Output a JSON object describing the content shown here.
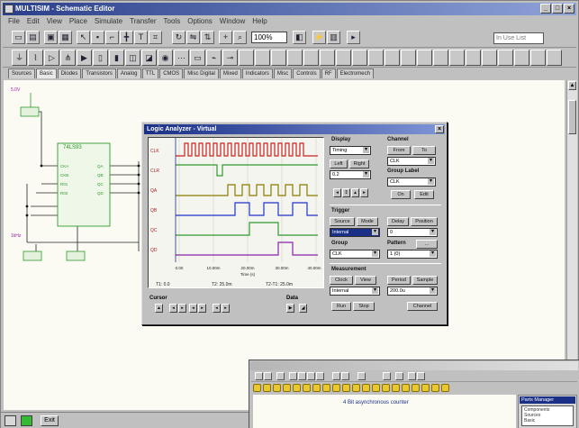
{
  "window": {
    "title": "MULTISIM - Schematic Editor",
    "controls": [
      "_",
      "□",
      "×"
    ]
  },
  "menubar": [
    "File",
    "Edit",
    "View",
    "Place",
    "Simulate",
    "Transfer",
    "Tools",
    "Options",
    "Window",
    "Help"
  ],
  "toolbar": {
    "zoom_value": "100%",
    "search_placeholder": "In Use List"
  },
  "component_tabs": [
    "Sources",
    "Basic",
    "Diodes",
    "Transistors",
    "Analog",
    "TTL",
    "CMOS",
    "Misc Digital",
    "Mixed",
    "Indicators",
    "Misc",
    "Controls",
    "RF",
    "Electromech"
  ],
  "schematic": {
    "ic_label": "74LS93",
    "source_label": "5.0V",
    "clock_label": "1kHz",
    "pins_left": [
      "CKA",
      "CKB",
      "R01",
      "R02"
    ],
    "pins_right": [
      "QA",
      "QB",
      "QC",
      "QD"
    ]
  },
  "logic_analyzer": {
    "title": "Logic Analyzer - Virtual",
    "close_label": "×",
    "channels": [
      "CLK",
      "CLR",
      "QA",
      "QB",
      "QC",
      "QD"
    ],
    "time_ticks": [
      "0.00",
      "10.00m",
      "20.00m",
      "30.00m",
      "40.00m"
    ],
    "x_axis_label": "Time (s)",
    "readouts": {
      "t1": "T1: 0.0",
      "t2": "T2: 25.0m",
      "t2_t1": "T2-T1: 25.0m"
    },
    "cursor_label": "Cursor",
    "data_label": "Data",
    "display": {
      "heading": "Display",
      "select_value": "Timing",
      "left_button": "Left",
      "right_button": "Right",
      "width_value": "0.2"
    },
    "channel": {
      "heading": "Channel",
      "from_button": "From",
      "to_button": "To",
      "select_value": "CLK"
    },
    "group_label": {
      "heading": "Group Label",
      "select_value": "CLK",
      "on_button": "On",
      "edit_button": "Edit"
    },
    "trigger": {
      "heading": "Trigger",
      "source_button": "Source",
      "mode_button": "Mode",
      "delay_button": "Delay",
      "position_button": "Position",
      "source_value": "Internal",
      "position_value": "0"
    },
    "group": {
      "heading": "Group",
      "select_value": "CLK"
    },
    "pattern": {
      "heading": "Pattern",
      "select_value": "1 (0)",
      "more_button": "..."
    },
    "measurement": {
      "heading": "Measurement",
      "clock_button": "Clock",
      "view_button": "View",
      "period_button": "Period",
      "sample_button": "Sample",
      "clock_value": "Internal",
      "period_value": "200.0u",
      "run_button": "Run",
      "stop_button": "Stop",
      "channel_button": "Channel"
    }
  },
  "second_window": {
    "heading": "4 Bit asynchronous counter",
    "panel_title": "Parts Manager",
    "panel_items": [
      "Components",
      "Sources",
      "Basic"
    ]
  },
  "statusbar": {
    "exit_label": "Exit"
  },
  "colors": {
    "title_bar": "#2a3f8a",
    "canvas": "#fbfbf4",
    "wire_green": "#2f9a2f",
    "trace_red": "#cc2222",
    "trace_olive": "#8a7a00",
    "trace_blue": "#2233cc",
    "trace_purple": "#8a22aa"
  }
}
